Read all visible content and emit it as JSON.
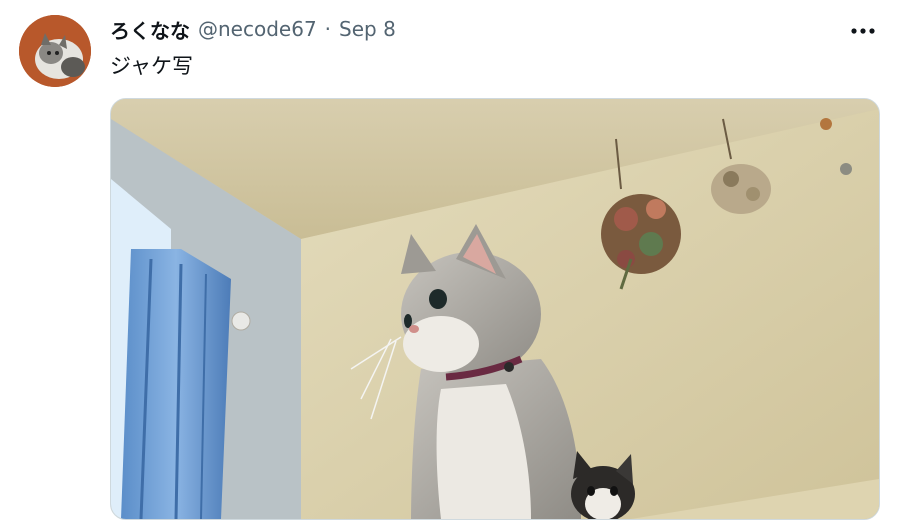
{
  "tweet": {
    "author_name": "ろくなな",
    "handle": "@necode67",
    "separator": "·",
    "date": "Sep 8",
    "text": "ジャケ写"
  },
  "icons": {
    "more": "more-horizontal-icon"
  },
  "colors": {
    "author_name": "#0f1419",
    "secondary_text": "#536471",
    "background": "#ffffff"
  }
}
